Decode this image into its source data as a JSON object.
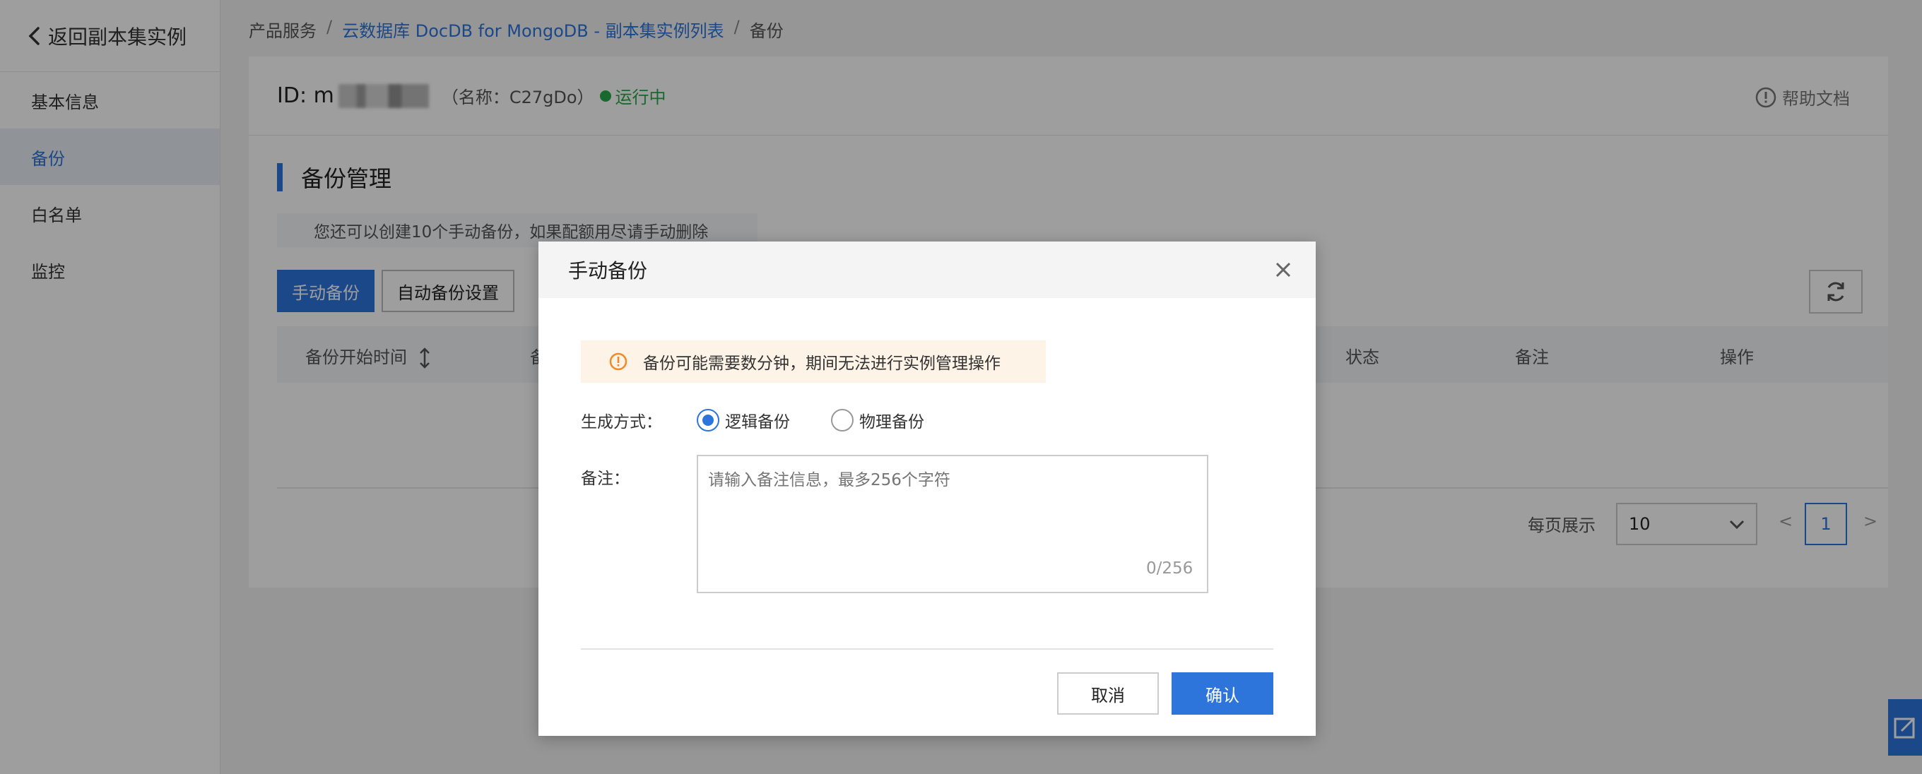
{
  "sidebar": {
    "back_label": "返回副本集实例",
    "items": [
      {
        "label": "基本信息",
        "active": false
      },
      {
        "label": "备份",
        "active": true
      },
      {
        "label": "白名单",
        "active": false
      },
      {
        "label": "监控",
        "active": false
      }
    ]
  },
  "breadcrumb": {
    "root": "产品服务",
    "parent": "云数据库 DocDB for MongoDB - 副本集实例列表",
    "current": "备份"
  },
  "header": {
    "id_prefix": "ID: m",
    "name_text": "（名称：C27gDo）",
    "status": "运行中",
    "help": "帮助文档"
  },
  "panel": {
    "title": "备份管理",
    "tip": "您还可以创建10个手动备份，如果配额用尽请手动删除",
    "manual_backup": "手动备份",
    "auto_backup_settings": "自动备份设置",
    "columns": [
      "备份开始时间",
      "备",
      "状态",
      "备注",
      "操作"
    ],
    "page_size_label": "每页展示",
    "page_size": "10",
    "current_page": "1",
    "prev": "<",
    "next": ">"
  },
  "modal": {
    "title": "手动备份",
    "warning": "备份可能需要数分钟，期间无法进行实例管理操作",
    "method_label": "生成方式：",
    "options": [
      {
        "label": "逻辑备份",
        "checked": true
      },
      {
        "label": "物理备份",
        "checked": false
      }
    ],
    "remark_label": "备注：",
    "remark_placeholder": "请输入备注信息，最多256个字符",
    "counter": "0/256",
    "cancel": "取消",
    "confirm": "确认"
  },
  "colors": {
    "primary": "#2d74db",
    "running": "#29a84a",
    "warning": "#f08a24"
  }
}
